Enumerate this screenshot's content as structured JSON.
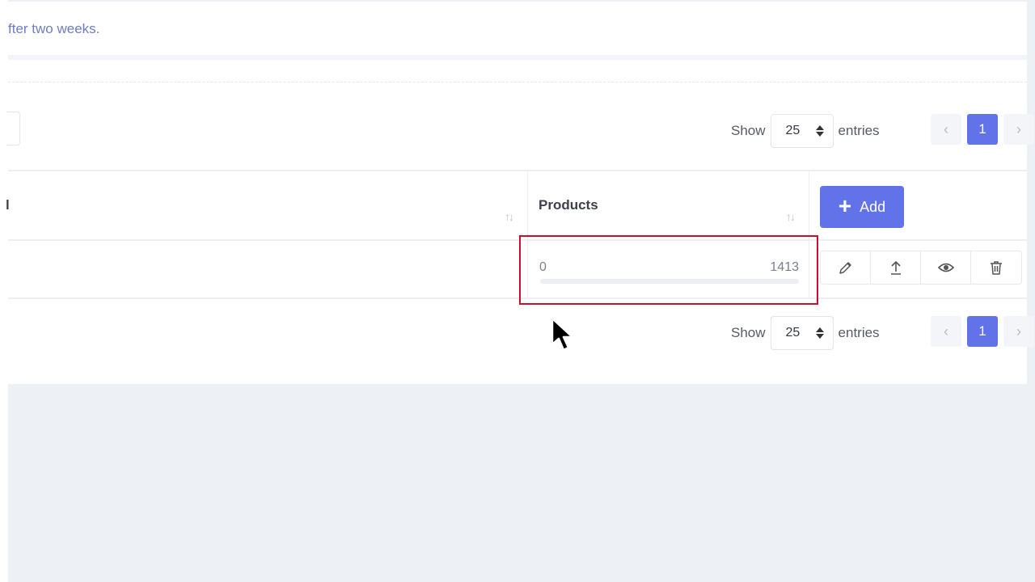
{
  "notice": {
    "text": "fter two weeks."
  },
  "length_control": {
    "show_label": "Show",
    "value": "25",
    "entries_label": "entries"
  },
  "pagination": {
    "prev": "‹",
    "current": "1",
    "next": "›"
  },
  "table": {
    "column_products": "Products",
    "add_button_label": "Add",
    "row": {
      "progress_min": "0",
      "progress_max": "1413",
      "progress_value": 0
    }
  },
  "icons": [
    "chevron-left-icon",
    "chevron-right-icon",
    "sort-icon",
    "plus-icon",
    "pencil-icon",
    "upload-icon",
    "eye-icon",
    "trash-icon",
    "mouse-cursor-icon"
  ],
  "colors": {
    "accent": "#6272e8",
    "highlight_box": "#c8102e",
    "notice_text": "#6f7cc4"
  }
}
